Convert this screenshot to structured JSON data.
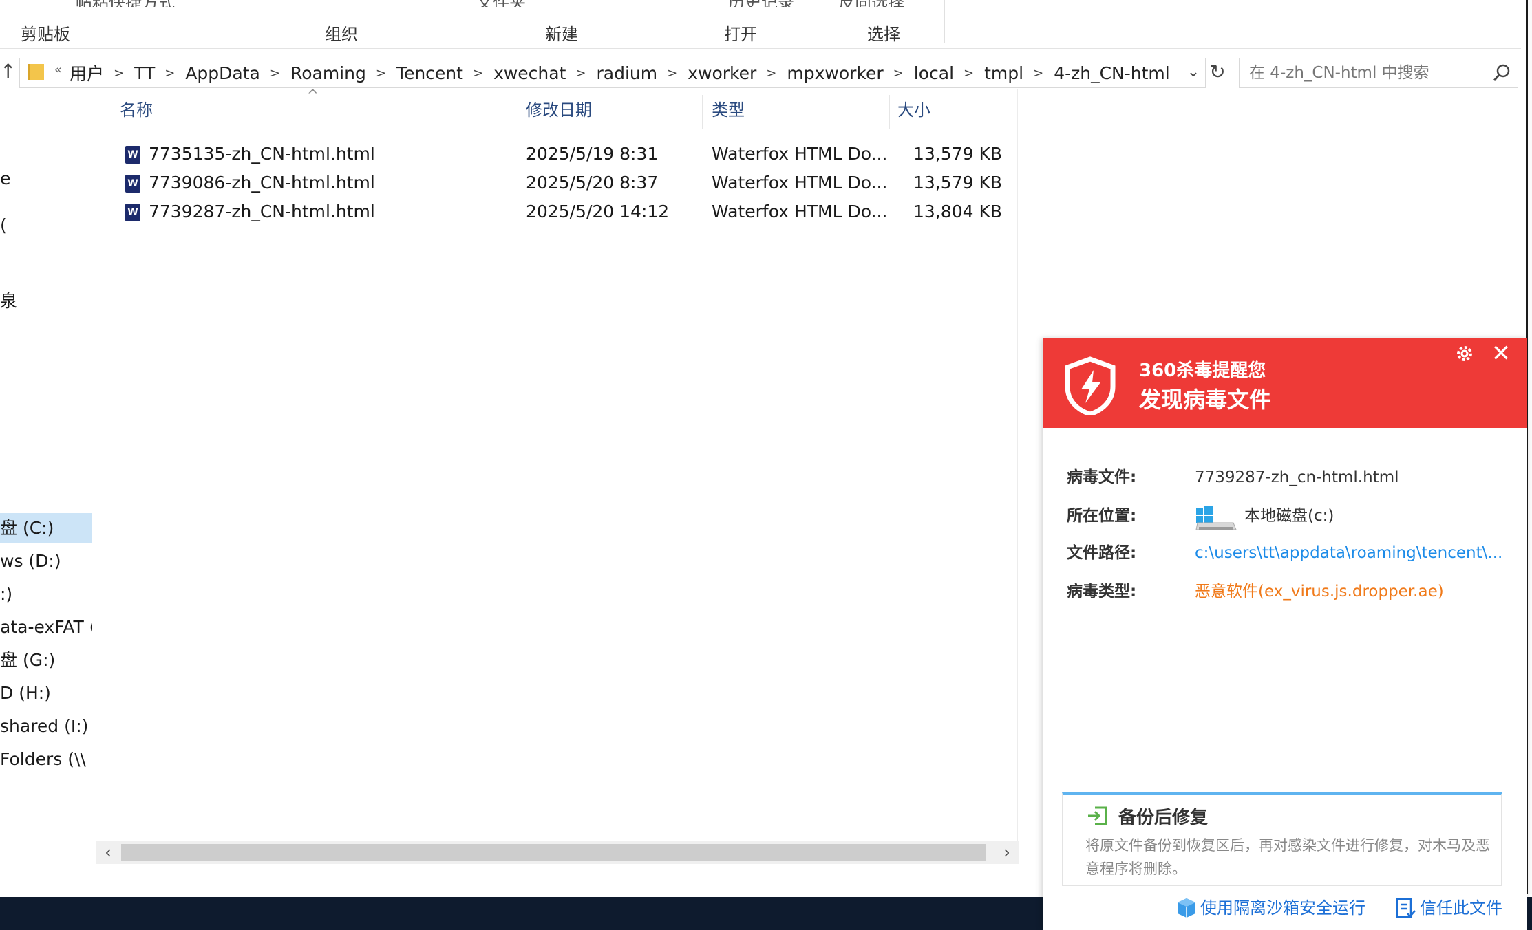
{
  "ribbon": {
    "clipped": [
      "帖粘快捷方式",
      "文件夹",
      "历史记录",
      "反向选择"
    ],
    "groups": [
      "剪贴板",
      "组织",
      "新建",
      "打开",
      "选择"
    ]
  },
  "address": {
    "more": "«",
    "crumbs": [
      "用户",
      "TT",
      "AppData",
      "Roaming",
      "Tencent",
      "xwechat",
      "radium",
      "xworker",
      "mpxworker",
      "local",
      "tmpl",
      "4-zh_CN-html"
    ]
  },
  "search": {
    "placeholder": "在 4-zh_CN-html 中搜索"
  },
  "sidebar": {
    "items": [
      "e",
      "(",
      "泉",
      "盘 (C:)",
      "ws (D:)",
      ":)",
      "ata-exFAT (F",
      "盘 (G:)",
      "D (H:)",
      "shared (I:)",
      " Folders (\\\\"
    ]
  },
  "columns": {
    "name": "名称",
    "date": "修改日期",
    "type": "类型",
    "size": "大小"
  },
  "files": [
    {
      "name": "7735135-zh_CN-html.html",
      "date": "2025/5/19 8:31",
      "type": "Waterfox HTML Do...",
      "size": "13,579 KB"
    },
    {
      "name": "7739086-zh_CN-html.html",
      "date": "2025/5/20 8:37",
      "type": "Waterfox HTML Do...",
      "size": "13,579 KB"
    },
    {
      "name": "7739287-zh_CN-html.html",
      "date": "2025/5/20 14:12",
      "type": "Waterfox HTML Do...",
      "size": "13,804 KB"
    }
  ],
  "popup": {
    "title1": "360杀毒提醒您",
    "title2": "发现病毒文件",
    "rows": {
      "file_label": "病毒文件:",
      "file_value": "7739287-zh_cn-html.html",
      "location_label": "所在位置:",
      "location_value": "本地磁盘(c:)",
      "path_label": "文件路径:",
      "path_value": "c:\\users\\tt\\appdata\\roaming\\tencent\\...",
      "type_label": "病毒类型:",
      "type_value": "恶意软件(ex_virus.js.dropper.ae)"
    },
    "fix": {
      "title": "备份后修复",
      "desc": "将原文件备份到恢复区后，再对感染文件进行修复，对木马及恶意程序将删除。"
    },
    "sandbox_link": "使用隔离沙箱安全运行",
    "trust_link": "信任此文件",
    "colors": {
      "header_red": "#ee3a37",
      "link_blue": "#1c8be8",
      "warning_orange": "#f07a1a"
    }
  }
}
